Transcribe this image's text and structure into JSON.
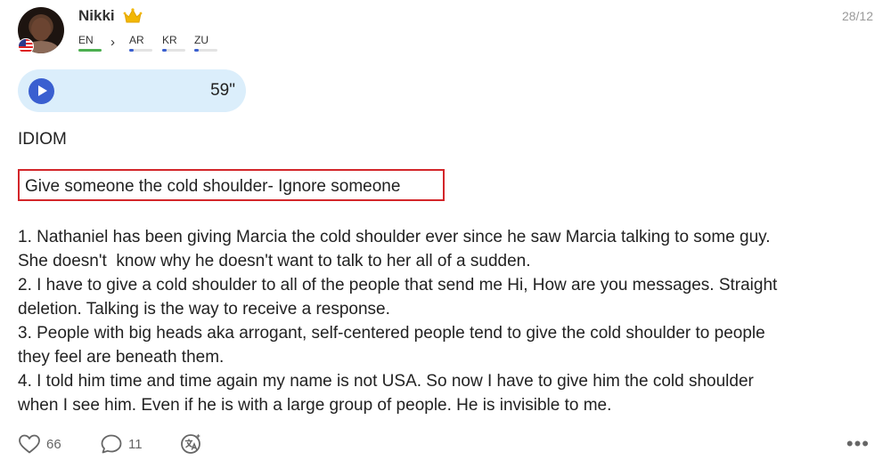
{
  "post": {
    "user": {
      "name": "Nikki",
      "crown_icon": "crown-icon",
      "flag_icon": "us-flag-icon"
    },
    "date": "28/12",
    "languages": {
      "native": [
        {
          "code": "EN",
          "level": 1.0,
          "color": "#4caf50"
        }
      ],
      "learning": [
        {
          "code": "AR",
          "level": 0.2,
          "color": "#3a5fd0"
        },
        {
          "code": "KR",
          "level": 0.2,
          "color": "#3a5fd0"
        },
        {
          "code": "ZU",
          "level": 0.2,
          "color": "#3a5fd0"
        }
      ]
    },
    "voice": {
      "duration": "59\""
    },
    "heading": "IDIOM",
    "highlight": "Give someone the cold shoulder- Ignore someone",
    "lines": [
      "1. Nathaniel has been giving Marcia the cold shoulder ever since he saw Marcia talking to some guy.",
      "She doesn't  know why he doesn't want to talk to her all of a sudden.",
      "2. I have to give a cold shoulder to all of the people that send me Hi, How are you messages. Straight",
      "deletion. Talking is the way to receive a response.",
      "3. People with big heads aka arrogant, self-centered people tend to give the cold shoulder to people",
      "they feel are beneath them.",
      "4. I told him time and time again my name is not USA. So now I have to give him the cold shoulder",
      "when I see him. Even if he is with a large group of people. He is invisible to me."
    ],
    "actions": {
      "likes": "66",
      "comments": "11"
    }
  },
  "colors": {
    "accent": "#3a5fd0",
    "highlight_border": "#d3262a",
    "voice_bg": "#dbeefb"
  }
}
